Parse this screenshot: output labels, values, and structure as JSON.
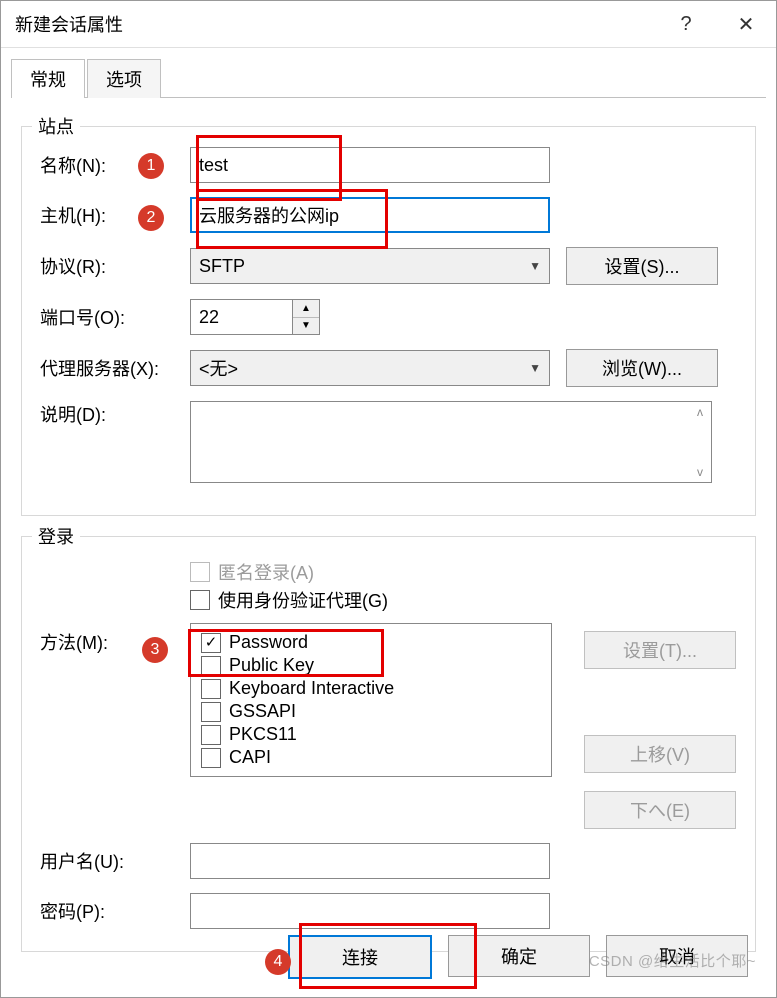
{
  "window_title": "新建会话属性",
  "tabs": {
    "general": "常规",
    "options": "选项"
  },
  "site": {
    "legend": "站点",
    "name_label": "名称(N):",
    "name_value": "test",
    "host_label": "主机(H):",
    "host_value": "云服务器的公网ip",
    "protocol_label": "协议(R):",
    "protocol_value": "SFTP",
    "settings_btn": "设置(S)...",
    "port_label": "端口号(O):",
    "port_value": "22",
    "proxy_label": "代理服务器(X):",
    "proxy_value": "<无>",
    "browse_btn": "浏览(W)...",
    "desc_label": "说明(D):"
  },
  "login": {
    "legend": "登录",
    "anon": "匿名登录(A)",
    "use_agent": "使用身份验证代理(G)",
    "method_label": "方法(M):",
    "methods": {
      "password": "Password",
      "public_key": "Public Key",
      "keyboard": "Keyboard Interactive",
      "gssapi": "GSSAPI",
      "pkcs11": "PKCS11",
      "capi": "CAPI"
    },
    "settings_btn": "设置(T)...",
    "move_up": "上移(V)",
    "move_down": "下へ(E)",
    "user_label": "用户名(U):",
    "pass_label": "密码(P):"
  },
  "footer": {
    "connect": "连接",
    "ok": "确定",
    "cancel": "取消"
  },
  "annotations": {
    "b1": "1",
    "b2": "2",
    "b3": "3",
    "b4": "4"
  },
  "watermark": "CSDN @给生活比个耶~"
}
